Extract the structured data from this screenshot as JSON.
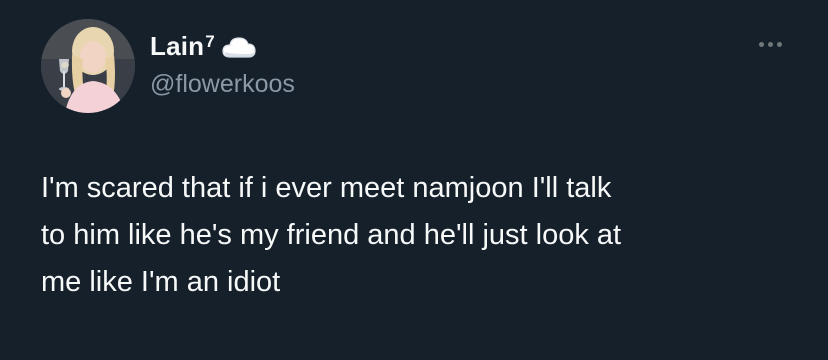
{
  "author": {
    "display_name": "Lain",
    "name_superscript": "7",
    "name_emoji_icon": "cloud-icon",
    "handle": "@flowerkoos",
    "avatar_icon": "profile-photo"
  },
  "actions": {
    "more_icon": "more-horizontal-icon"
  },
  "tweet": {
    "text_lines": [
      "I'm scared that if i ever meet namjoon I'll talk",
      "to him like he's my friend and he'll just look at",
      "me like I'm an idiot"
    ]
  },
  "colors": {
    "background": "#15202b",
    "primary_text": "#f7f9f9",
    "secondary_text": "#8b98a5"
  }
}
